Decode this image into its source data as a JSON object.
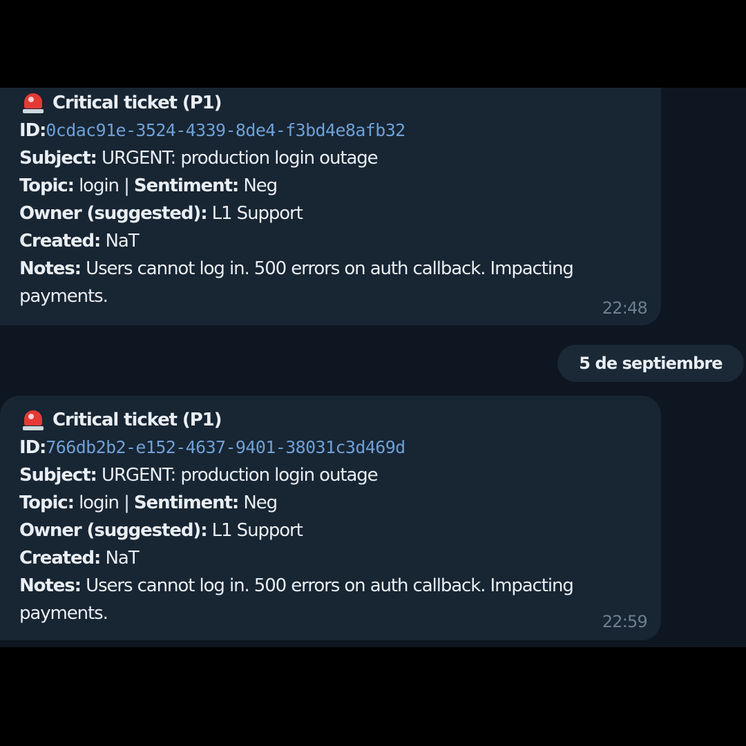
{
  "date_separator": "5 de septiembre",
  "labels": {
    "id": "ID:",
    "subject": "Subject:",
    "topic": "Topic:",
    "separator": "|",
    "sentiment": "Sentiment:",
    "owner": "Owner (suggested):",
    "created": "Created:",
    "notes": "Notes:"
  },
  "messages": [
    {
      "icon": "siren-icon",
      "title": "Critical ticket (P1)",
      "id": "0cdac91e-3524-4339-8de4-f3bd4e8afb32",
      "subject": "URGENT: production login outage",
      "topic": "login",
      "sentiment": "Neg",
      "owner": "L1 Support",
      "created": "NaT",
      "notes_line1": "Users cannot log in. 500 errors on auth callback. Impacting",
      "notes_line2": "payments.",
      "time": "22:48"
    },
    {
      "icon": "siren-icon",
      "title": "Critical ticket (P1)",
      "id": "766db2b2-e152-4637-9401-38031c3d469d",
      "subject": "URGENT: production login outage",
      "topic": "login",
      "sentiment": "Neg",
      "owner": "L1 Support",
      "created": "NaT",
      "notes_line1": "Users cannot log in. 500 errors on auth callback. Impacting",
      "notes_line2": "payments.",
      "time": "22:59"
    }
  ],
  "colors": {
    "chat_background": "#0e1621",
    "bubble": "#182533",
    "id_link": "#6ea0d6",
    "timestamp": "#6d7f8f"
  }
}
